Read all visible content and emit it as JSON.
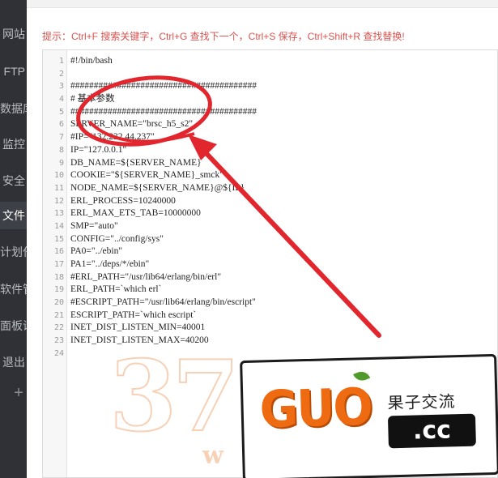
{
  "sidebar": {
    "items": [
      {
        "label": "网站"
      },
      {
        "label": "FTP"
      },
      {
        "label": "数据库"
      },
      {
        "label": "监控"
      },
      {
        "label": "安全"
      },
      {
        "label": "文件",
        "active": true
      },
      {
        "label": "计划任务"
      },
      {
        "label": "软件管理"
      },
      {
        "label": "面板设置"
      },
      {
        "label": "退出"
      }
    ],
    "add_icon": "plus-icon"
  },
  "hint": "提示：Ctrl+F 搜索关键字，Ctrl+G 查找下一个，Ctrl+S 保存，Ctrl+Shift+R 查找替换!",
  "editor": {
    "lines": [
      {
        "n": "1",
        "text": "#!/bin/bash"
      },
      {
        "n": "2",
        "text": ""
      },
      {
        "n": "3",
        "text": "########################################"
      },
      {
        "n": "4",
        "text": "# 基本参数"
      },
      {
        "n": "5",
        "text": "########################################"
      },
      {
        "n": "6",
        "text": "SERVER_NAME=\"brsc_h5_s2\""
      },
      {
        "n": "7",
        "text": "#IP=\"132.232.44.237\""
      },
      {
        "n": "8",
        "text": "IP=\"127.0.0.1\""
      },
      {
        "n": "9",
        "text": "DB_NAME=${SERVER_NAME}"
      },
      {
        "n": "10",
        "text": "COOKIE=\"${SERVER_NAME}_smck\""
      },
      {
        "n": "11",
        "text": "NODE_NAME=${SERVER_NAME}@${IP}"
      },
      {
        "n": "12",
        "text": "ERL_PROCESS=10240000"
      },
      {
        "n": "13",
        "text": "ERL_MAX_ETS_TAB=10000000"
      },
      {
        "n": "14",
        "text": "SMP=\"auto\""
      },
      {
        "n": "15",
        "text": "CONFIG=\"../config/sys\""
      },
      {
        "n": "16",
        "text": "PA0=\"../ebin\""
      },
      {
        "n": "17",
        "text": "PA1=\"../deps/*/ebin\""
      },
      {
        "n": "18",
        "text": "#ERL_PATH=\"/usr/lib64/erlang/bin/erl\""
      },
      {
        "n": "19",
        "text": "ERL_PATH=`which erl`"
      },
      {
        "n": "20",
        "text": "#ESCRIPT_PATH=\"/usr/lib64/erlang/bin/escript\""
      },
      {
        "n": "21",
        "text": "ESCRIPT_PATH=`which escript`"
      },
      {
        "n": "22",
        "text": "INET_DIST_LISTEN_MIN=40001"
      },
      {
        "n": "23",
        "text": "INET_DIST_LISTEN_MAX=40200"
      },
      {
        "n": "24",
        "text": ""
      }
    ]
  },
  "watermark": {
    "digits": "37",
    "letter": "w"
  },
  "logo": {
    "brand": "GUO",
    "cn": "果子交流",
    "tld": ".cc"
  },
  "colors": {
    "hint": "#d9534f",
    "annotation": "#e2262e",
    "brand_orange": "#ee6b12",
    "sidebar_bg": "#2f3136"
  }
}
